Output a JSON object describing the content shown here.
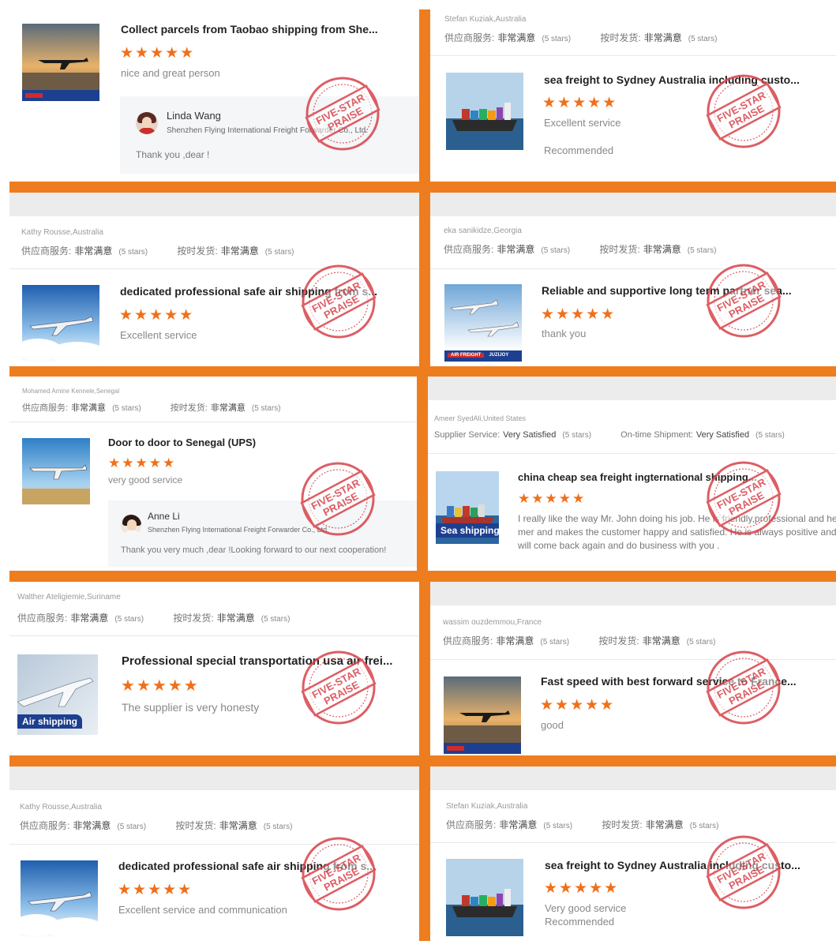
{
  "stamp": {
    "text": "FIVE-STAR PRAISE"
  },
  "cards": [
    {
      "id": "c1",
      "title": "Collect parcels from Taobao shipping from She...",
      "comment": "nice and great person",
      "image": "air-freight-plane-runway",
      "reply": {
        "name": "Linda Wang",
        "company": "Shenzhen Flying International Freight Forwarder Co., Ltd.",
        "text": "Thank you ,dear !"
      }
    },
    {
      "id": "c2",
      "reviewer": "Stefan Kuziak,Australia",
      "rating1": {
        "label": "供应商服务:",
        "value": "非常满意",
        "count": "(5 stars)"
      },
      "rating2": {
        "label": "按时发货:",
        "value": "非常满意",
        "count": "(5 stars)"
      },
      "title": "sea freight to Sydney Australia including custo...",
      "comment": "Excellent service",
      "comment2": "Recommended",
      "image": "container-ship-sea"
    },
    {
      "id": "c3",
      "reviewer": "Kathy Rousse,Australia",
      "rating1": {
        "label": "供应商服务:",
        "value": "非常满意",
        "count": "(5 stars)"
      },
      "rating2": {
        "label": "按时发货:",
        "value": "非常满意",
        "count": "(5 stars)"
      },
      "title": "dedicated professional safe air shipping from s...",
      "comment": "Excellent service",
      "image": "plane-above-clouds"
    },
    {
      "id": "c4",
      "reviewer": "eka sanikidze,Georgia",
      "rating1": {
        "label": "供应商服务:",
        "value": "非常满意",
        "count": "(5 stars)"
      },
      "rating2": {
        "label": "按时发货:",
        "value": "非常满意",
        "count": "(5 stars)"
      },
      "title": "Reliable and supportive long term partner sea...",
      "comment": "thank you",
      "image": "air-freight-two-planes",
      "strip": {
        "left": "AIR FREIGHT",
        "right": "JUZIJOY"
      }
    },
    {
      "id": "c5",
      "reviewer": "Mohamed Amine Kennele,Senegal",
      "rating1": {
        "label": "供应商服务:",
        "value": "非常满意",
        "count": "(5 stars)"
      },
      "rating2": {
        "label": "按时发货:",
        "value": "非常满意",
        "count": "(5 stars)"
      },
      "title": "Door to door to Senegal (UPS)",
      "comment": "very good service",
      "image": "plane-landing-runway",
      "reply": {
        "name": "Anne Li",
        "company": "Shenzhen Flying International Freight Forwarder Co., Ltd.",
        "text": "Thank you very much ,dear !Looking forward to our next cooperation!"
      }
    },
    {
      "id": "c6",
      "reviewer": "Ameer SyedAli,United States",
      "rating1": {
        "label": "Supplier Service:",
        "value": "Very Satisfied",
        "count": "(5 stars)"
      },
      "rating2": {
        "label": "On-time Shipment:",
        "value": "Very Satisfied",
        "count": "(5 stars)"
      },
      "title": "china cheap sea freight ingternational shipping...",
      "comment_lines": [
        "I really like the way Mr. John doing his job. He is friendly,professional and he kno",
        "mer and makes the customer happy and satisfied. He is always positive and happy",
        "will come back again and do business with you ."
      ],
      "image": "sea-shipping",
      "badge": "Sea shipping"
    },
    {
      "id": "c7",
      "reviewer": "Walther Ateligiemie,Suriname",
      "rating1": {
        "label": "供应商服务:",
        "value": "非常满意",
        "count": "(5 stars)"
      },
      "rating2": {
        "label": "按时发货:",
        "value": "非常满意",
        "count": "(5 stars)"
      },
      "title": "Professional special transportation usa air frei...",
      "comment": "The supplier is very honesty",
      "image": "air-shipping",
      "badge": "Air shipping"
    },
    {
      "id": "c8",
      "reviewer": "wassim ouzdemmou,France",
      "rating1": {
        "label": "供应商服务:",
        "value": "非常满意",
        "count": "(5 stars)"
      },
      "rating2": {
        "label": "按时发货:",
        "value": "非常满意",
        "count": "(5 stars)"
      },
      "title": "Fast speed with best forward service to France...",
      "comment": "good",
      "image": "air-freight-plane-runway"
    },
    {
      "id": "c9",
      "reviewer": "Kathy Rousse,Australia",
      "rating1": {
        "label": "供应商服务:",
        "value": "非常满意",
        "count": "(5 stars)"
      },
      "rating2": {
        "label": "按时发货:",
        "value": "非常满意",
        "count": "(5 stars)"
      },
      "title": "dedicated professional safe air shipping from s...",
      "comment": "Excellent service and communication",
      "image": "plane-above-clouds"
    },
    {
      "id": "c10",
      "reviewer": "Stefan Kuziak,Australia",
      "rating1": {
        "label": "供应商服务:",
        "value": "非常满意",
        "count": "(5 stars)"
      },
      "rating2": {
        "label": "按时发货:",
        "value": "非常满意",
        "count": "(5 stars)"
      },
      "title": "sea freight to Sydney Australia including custo...",
      "comment": "Very good service",
      "comment2": "Recommended",
      "image": "container-ship-sea"
    }
  ],
  "star_glyphs": "★★★★★",
  "star_rating": 5,
  "colors": {
    "frame": "#ee7d1f",
    "stars": "#f0701a",
    "stamp": "#d8424a"
  }
}
